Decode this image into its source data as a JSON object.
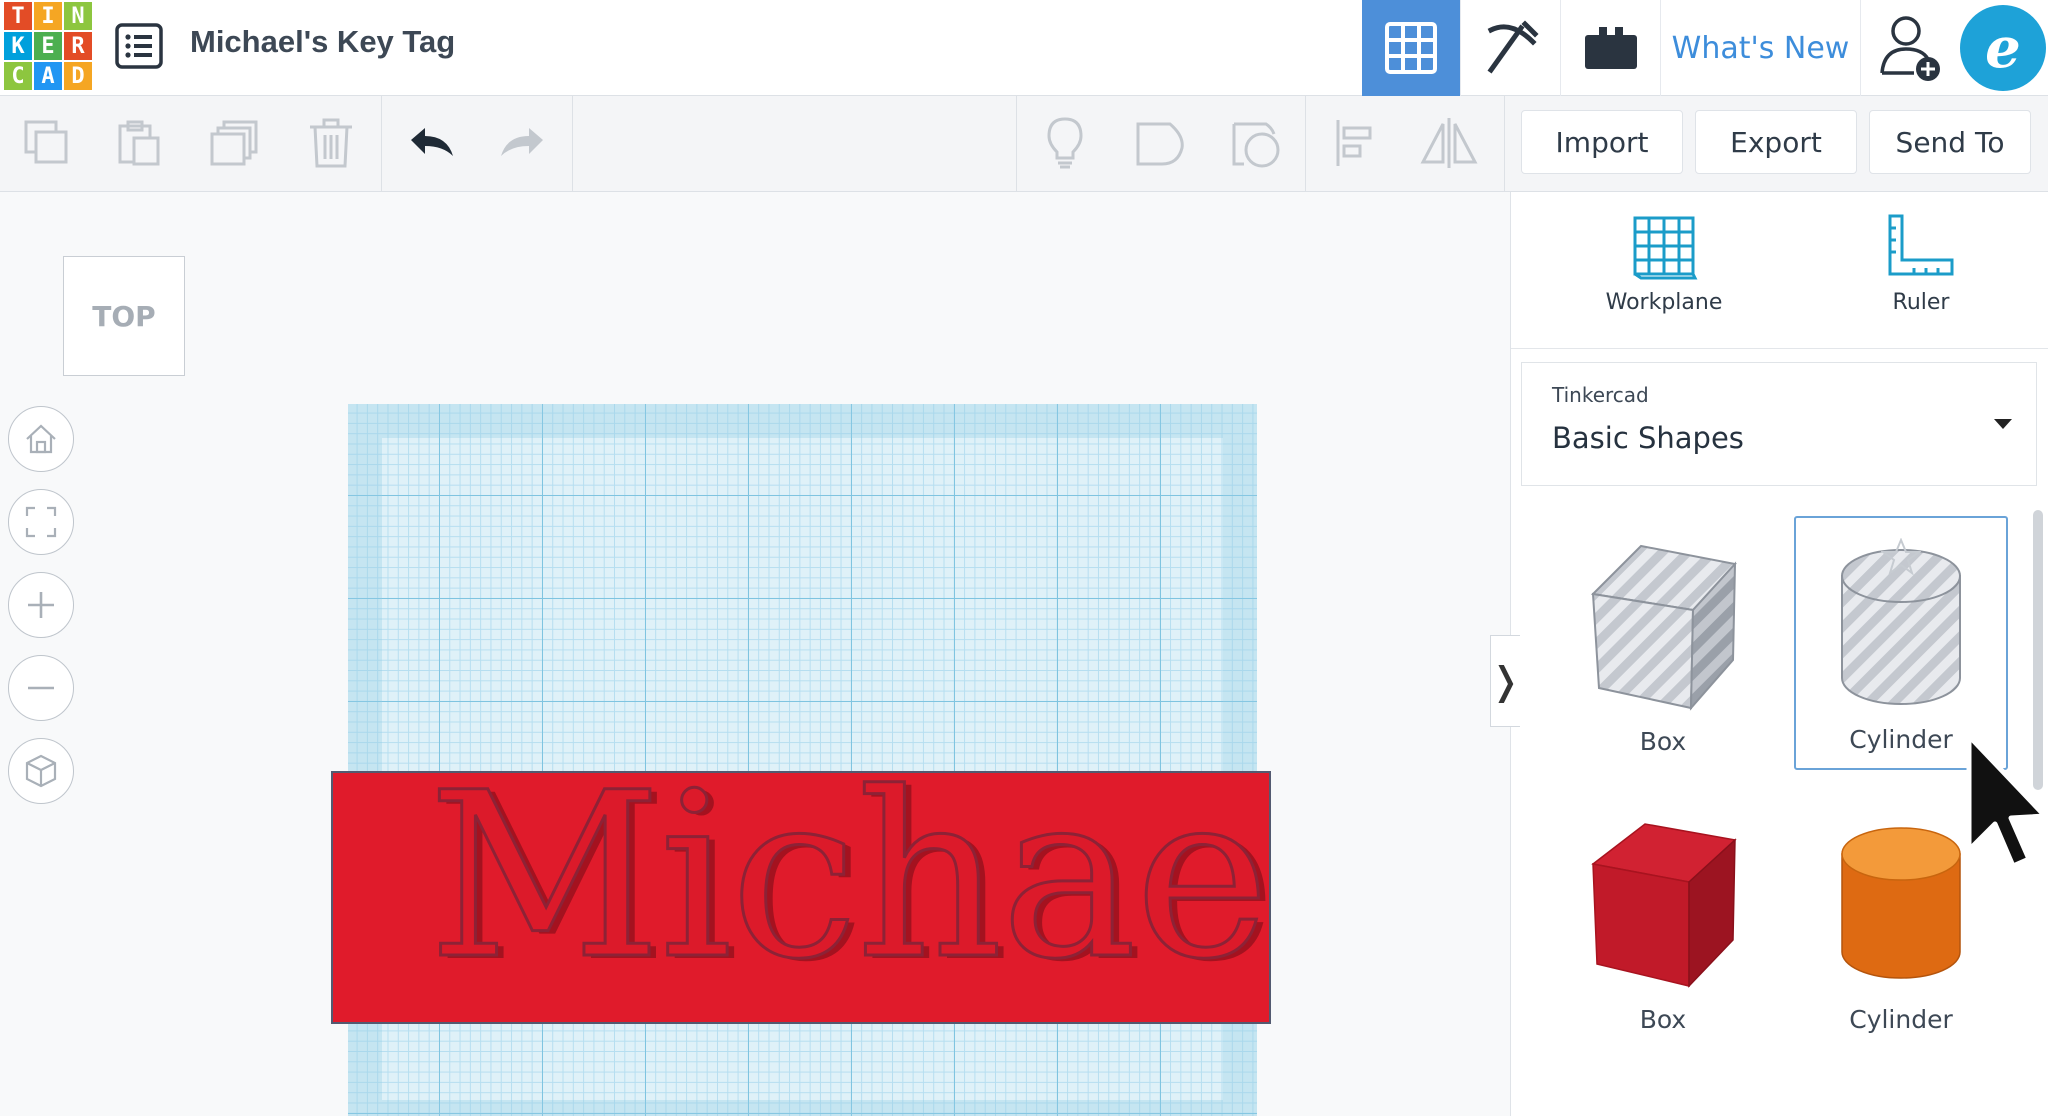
{
  "app": {
    "logo_letters": [
      "T",
      "I",
      "N",
      "K",
      "E",
      "R",
      "C",
      "A",
      "D"
    ],
    "logo_colors": [
      "#e34c26",
      "#f5a623",
      "#8dc63f",
      "#00a0dc",
      "#4caf50",
      "#e34c26",
      "#8dc63f",
      "#2196f3",
      "#f5a623"
    ],
    "document_title": "Michael's Key Tag"
  },
  "header": {
    "whats_new_label": "What's New",
    "avatar_letter": "e",
    "accent": "#4d8fd9"
  },
  "toolbar": {
    "import_label": "Import",
    "export_label": "Export",
    "send_to_label": "Send To"
  },
  "viewport": {
    "view_cube_label": "TOP",
    "tag_text": "Michael",
    "tag_color": "#e01b2b"
  },
  "panel": {
    "tools": [
      {
        "label": "Workplane",
        "icon": "workplane-icon"
      },
      {
        "label": "Ruler",
        "icon": "ruler-icon"
      }
    ],
    "library": {
      "category": "Tinkercad",
      "selected": "Basic Shapes"
    },
    "shapes": [
      {
        "label": "Box",
        "style": "hole"
      },
      {
        "label": "Cylinder",
        "style": "hole",
        "selected": true
      },
      {
        "label": "Box",
        "style": "solid",
        "color": "#d61f2b"
      },
      {
        "label": "Cylinder",
        "style": "solid",
        "color": "#e8771c"
      }
    ]
  }
}
